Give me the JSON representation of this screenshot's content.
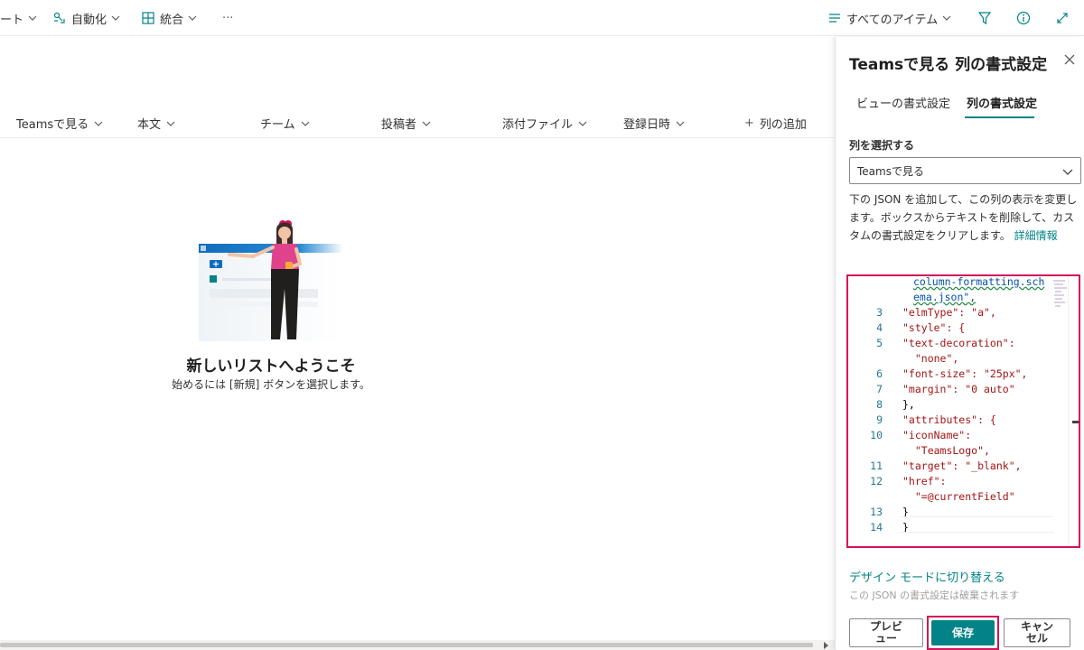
{
  "toolbar": {
    "partial_item": "ート",
    "automate": "自動化",
    "integrate": "統合",
    "more": "···",
    "view_selector": "すべてのアイテム",
    "icons": [
      "automate-icon",
      "integrate-icon",
      "view-list-icon",
      "filter-icon",
      "info-icon",
      "expand-icon"
    ]
  },
  "list": {
    "columns": [
      {
        "label": "Teamsで見る"
      },
      {
        "label": "本文"
      },
      {
        "label": "チーム"
      },
      {
        "label": "投稿者"
      },
      {
        "label": "添付ファイル"
      },
      {
        "label": "登録日時"
      }
    ],
    "add_column": "列の追加",
    "add_column_icon": "+",
    "empty_title": "新しいリストへようこそ",
    "empty_subtitle": "始めるには [新規] ボタンを選択します。"
  },
  "panel": {
    "title": "Teamsで見る 列の書式設定",
    "tabs": [
      "ビューの書式設定",
      "列の書式設定"
    ],
    "active_tab": "列の書式設定",
    "select_label": "列を選択する",
    "selected_column": "Teamsで見る",
    "description": "下の JSON を追加して、この列の表示を変更します。ボックスからテキストを削除して、カスタムの書式設定をクリアします。",
    "learn_more": "詳細情報",
    "code_lines": [
      {
        "n": "",
        "text": "column-formatting.sch"
      },
      {
        "n": "",
        "text": "ema.json\","
      },
      {
        "n": "3",
        "text": "\"elmType\": \"a\","
      },
      {
        "n": "4",
        "text": "\"style\": {"
      },
      {
        "n": "5",
        "text": "\"text-decoration\":"
      },
      {
        "n": "",
        "text": "  \"none\","
      },
      {
        "n": "6",
        "text": "\"font-size\": \"25px\","
      },
      {
        "n": "7",
        "text": "\"margin\": \"0 auto\""
      },
      {
        "n": "8",
        "text": "},"
      },
      {
        "n": "9",
        "text": "\"attributes\": {"
      },
      {
        "n": "10",
        "text": "\"iconName\":"
      },
      {
        "n": "",
        "text": "  \"TeamsLogo\","
      },
      {
        "n": "11",
        "text": "\"target\": \"_blank\","
      },
      {
        "n": "12",
        "text": "\"href\":"
      },
      {
        "n": "",
        "text": "  \"=@currentField\""
      },
      {
        "n": "13",
        "text": "}"
      },
      {
        "n": "14",
        "text": "}"
      }
    ],
    "design_mode_link": "デザイン モードに切り替える",
    "design_mode_note": "この JSON の書式設定は破棄されます",
    "buttons": {
      "preview": "プレビュー",
      "save": "保存",
      "cancel": "キャンセル"
    },
    "accent_color": "#038387",
    "highlight_color": "#d5115a"
  }
}
